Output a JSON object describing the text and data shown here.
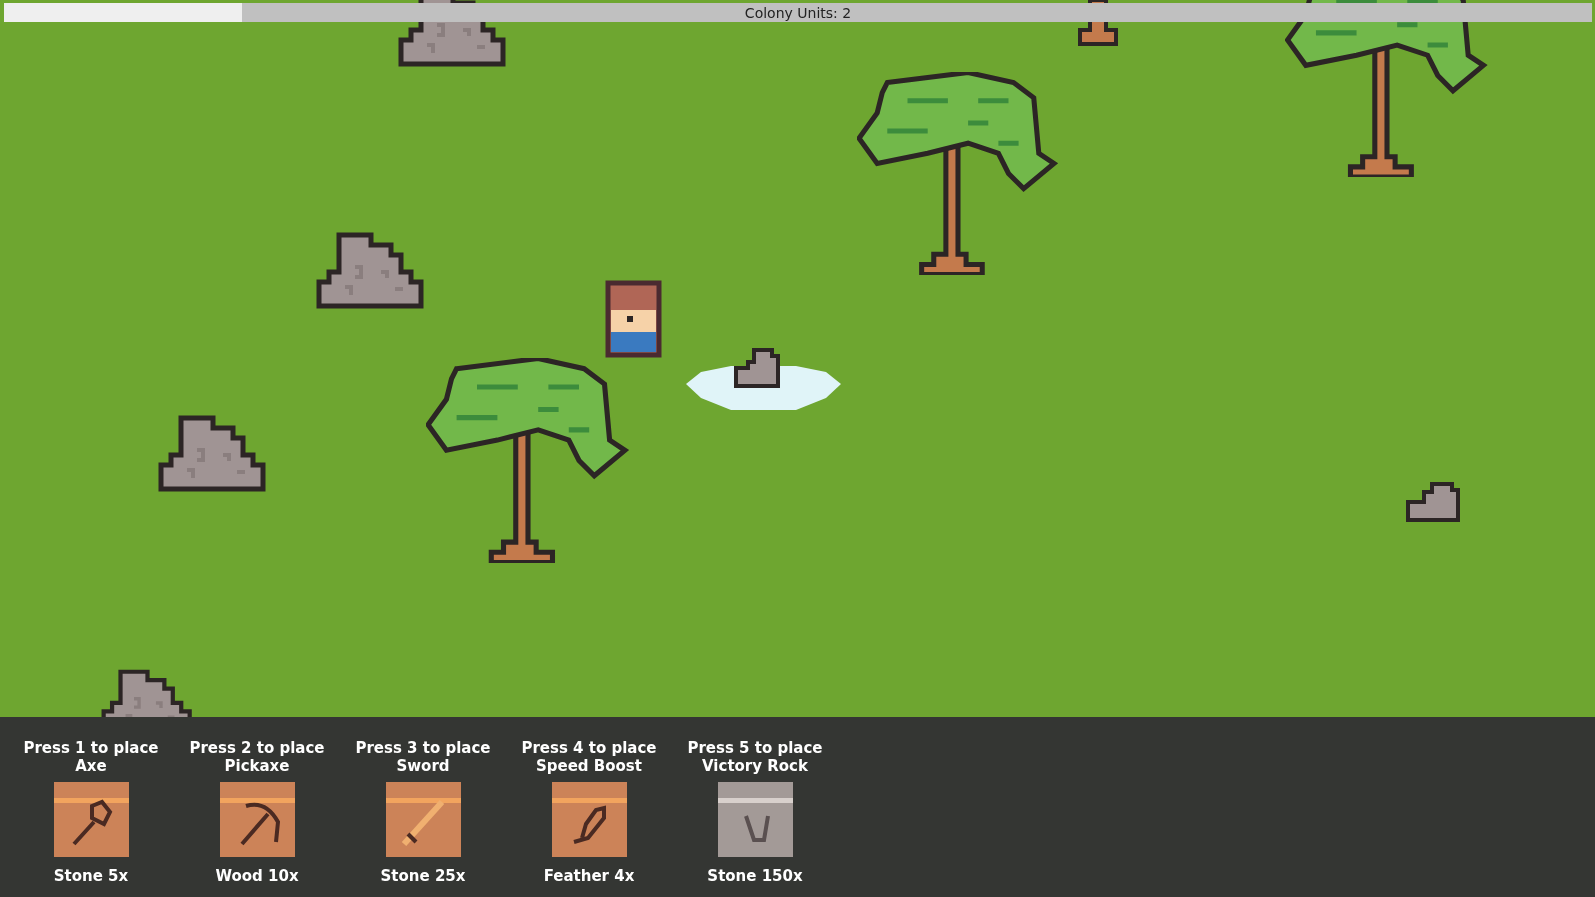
{
  "top_bar": {
    "label": "Colony Units: 2",
    "level": 0.15
  },
  "hotbar": [
    {
      "prompt": "Press 1 to place",
      "name": "Axe",
      "cost": "Stone 5x",
      "kind": "axe",
      "available": true
    },
    {
      "prompt": "Press 2 to place",
      "name": "Pickaxe",
      "cost": "Wood 10x",
      "kind": "pickaxe",
      "available": true
    },
    {
      "prompt": "Press 3 to place",
      "name": "Sword",
      "cost": "Stone 25x",
      "kind": "sword",
      "available": true
    },
    {
      "prompt": "Press 4 to place",
      "name": "Speed Boost",
      "cost": "Feather 4x",
      "kind": "feather",
      "available": true
    },
    {
      "prompt": "Press 5 to place",
      "name": "Victory Rock",
      "cost": "Stone 150x",
      "kind": "rock",
      "available": false
    }
  ]
}
